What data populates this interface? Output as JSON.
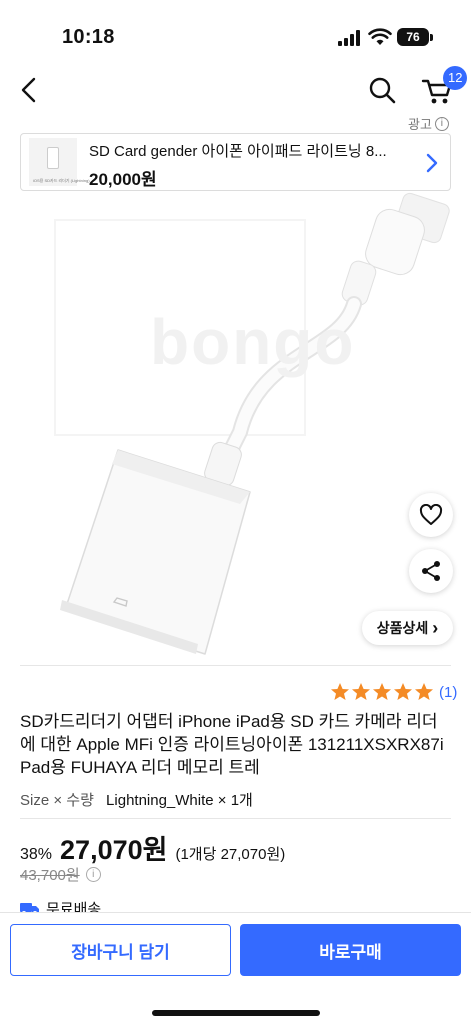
{
  "status_bar": {
    "time": "10:18",
    "battery": "76",
    "icons": [
      "cellular-signal-icon",
      "wifi-icon",
      "battery-icon"
    ]
  },
  "header": {
    "icons": [
      "chevron-left-icon",
      "search-icon",
      "cart-icon"
    ],
    "cart_count": "12"
  },
  "ad": {
    "label": "광고",
    "info_symbol": "i",
    "title": "SD Card gender 아이폰 아이패드 라이트닝 8...",
    "price": "20,000원",
    "thumb_caption": "iOS용 SD카드 리더기 (Lightning)"
  },
  "product_image": {
    "watermark": "bongo"
  },
  "image_actions": {
    "wish_icon": "heart-outline-icon",
    "share_icon": "share-icon",
    "detail_label": "상품상세",
    "detail_chevron": "›"
  },
  "rating": {
    "stars": 5,
    "count": "(1)",
    "star_color": "#f48b26"
  },
  "product": {
    "title": "SD카드리더기 어댑터 iPhone iPad용 SD 카드 카메라 리더에 대한 Apple MFi 인증 라이트닝아이폰 131211XSXRX87iPad용 FUHAYA 리더 메모리 트레",
    "option_label": "Size × 수량",
    "option_value": "Lightning_White × 1개"
  },
  "pricing": {
    "discount": "38%",
    "price": "27,070원",
    "unit_price": "(1개당 27,070원)",
    "original_price": "43,700원",
    "info_symbol": "i"
  },
  "shipping": {
    "label": "무료배송",
    "icon": "truck-icon",
    "icon_color": "#346aff"
  },
  "bottom_bar": {
    "cart_label": "장바구니 담기",
    "buy_label": "바로구매"
  },
  "colors": {
    "accent": "#346aff",
    "star": "#f48b26",
    "text": "#111111",
    "muted": "#888888"
  }
}
